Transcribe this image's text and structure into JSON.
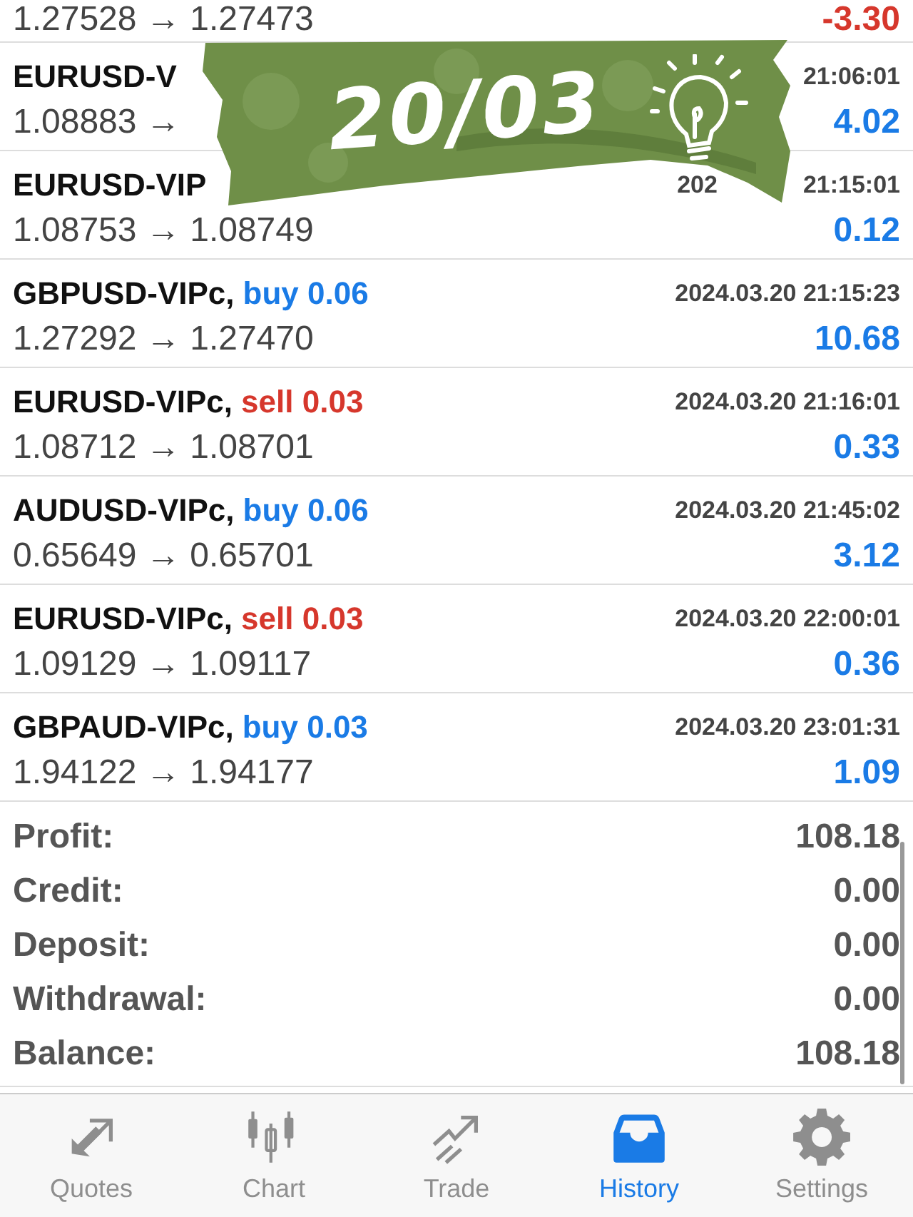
{
  "deals": [
    {
      "price": "1.27528 → 1.27473",
      "profit": "-3.30",
      "loss": true
    },
    {
      "symbol": "EURUSD-V",
      "time_parts": [
        "21:06:01"
      ],
      "price": "1.08883 →",
      "profit": "4.02",
      "loss": false
    },
    {
      "symbol": "EURUSD-VIP",
      "time_parts": [
        "202",
        "21:15:01"
      ],
      "price": "1.08753 → 1.08749",
      "profit": "0.12",
      "loss": false
    },
    {
      "symbol": "GBPUSD-VIPc,",
      "side": "buy",
      "volume": "0.06",
      "time_parts": [
        "2024.03.20 21:15:23"
      ],
      "price": "1.27292 → 1.27470",
      "profit": "10.68",
      "loss": false
    },
    {
      "symbol": "EURUSD-VIPc,",
      "side": "sell",
      "volume": "0.03",
      "time_parts": [
        "2024.03.20 21:16:01"
      ],
      "price": "1.08712 → 1.08701",
      "profit": "0.33",
      "loss": false
    },
    {
      "symbol": "AUDUSD-VIPc,",
      "side": "buy",
      "volume": "0.06",
      "time_parts": [
        "2024.03.20 21:45:02"
      ],
      "price": "0.65649 → 0.65701",
      "profit": "3.12",
      "loss": false
    },
    {
      "symbol": "EURUSD-VIPc,",
      "side": "sell",
      "volume": "0.03",
      "time_parts": [
        "2024.03.20 22:00:01"
      ],
      "price": "1.09129 → 1.09117",
      "profit": "0.36",
      "loss": false
    },
    {
      "symbol": "GBPAUD-VIPc,",
      "side": "buy",
      "volume": "0.03",
      "time_parts": [
        "2024.03.20 23:01:31"
      ],
      "price": "1.94122 → 1.94177",
      "profit": "1.09",
      "loss": false
    }
  ],
  "sticker": {
    "text": "20/03"
  },
  "summary": [
    {
      "label": "Profit:",
      "value": "108.18"
    },
    {
      "label": "Credit:",
      "value": "0.00"
    },
    {
      "label": "Deposit:",
      "value": "0.00"
    },
    {
      "label": "Withdrawal:",
      "value": "0.00"
    },
    {
      "label": "Balance:",
      "value": "108.18"
    }
  ],
  "tabs": [
    {
      "label": "Quotes",
      "selected": false
    },
    {
      "label": "Chart",
      "selected": false
    },
    {
      "label": "Trade",
      "selected": false
    },
    {
      "label": "History",
      "selected": true
    },
    {
      "label": "Settings",
      "selected": false
    }
  ]
}
